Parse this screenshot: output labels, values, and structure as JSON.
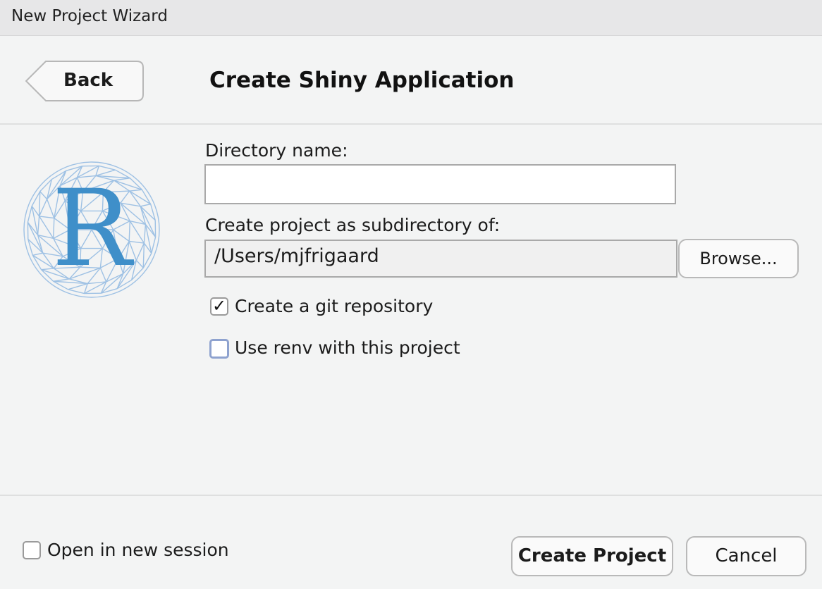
{
  "window": {
    "title": "New Project Wizard"
  },
  "header": {
    "back_label": "Back",
    "title": "Create Shiny Application"
  },
  "logo": {
    "letter": "R",
    "color": "#3f8fc9"
  },
  "form": {
    "directory_label": "Directory name:",
    "directory_value": "",
    "parent_label": "Create project as subdirectory of:",
    "parent_value": "/Users/mjfrigaard",
    "browse_label": "Browse...",
    "git_label": "Create a git repository",
    "git_checked": true,
    "renv_label": "Use renv with this project",
    "renv_checked": false
  },
  "footer": {
    "new_session_label": "Open in new session",
    "new_session_checked": false,
    "create_label": "Create Project",
    "cancel_label": "Cancel"
  }
}
